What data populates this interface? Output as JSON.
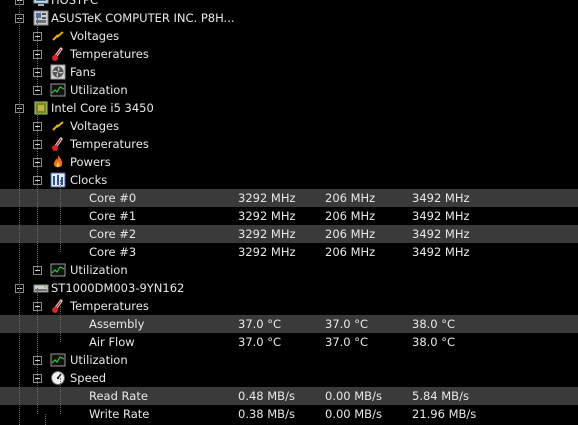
{
  "tree": {
    "root": {
      "label": "HOSTPC"
    },
    "motherboard": {
      "label": "ASUSTeK COMPUTER INC. P8H...",
      "children": [
        "Voltages",
        "Temperatures",
        "Fans",
        "Utilization"
      ]
    },
    "cpu": {
      "label": "Intel Core i5 3450",
      "children": {
        "voltages": "Voltages",
        "temperatures": "Temperatures",
        "powers": "Powers",
        "clocks": "Clocks",
        "utilization": "Utilization"
      },
      "clocks": [
        {
          "name": "Core #0",
          "value": "3292 MHz",
          "min": "206 MHz",
          "max": "3492 MHz"
        },
        {
          "name": "Core #1",
          "value": "3292 MHz",
          "min": "206 MHz",
          "max": "3492 MHz"
        },
        {
          "name": "Core #2",
          "value": "3292 MHz",
          "min": "206 MHz",
          "max": "3492 MHz"
        },
        {
          "name": "Core #3",
          "value": "3292 MHz",
          "min": "206 MHz",
          "max": "3492 MHz"
        }
      ]
    },
    "hdd": {
      "label": "ST1000DM003-9YN162",
      "children": {
        "temperatures": "Temperatures",
        "utilization": "Utilization",
        "speed": "Speed"
      },
      "temps": [
        {
          "name": "Assembly",
          "value": "37.0 °C",
          "min": "37.0 °C",
          "max": "38.0 °C"
        },
        {
          "name": "Air Flow",
          "value": "37.0 °C",
          "min": "37.0 °C",
          "max": "38.0 °C"
        }
      ],
      "speeds": [
        {
          "name": "Read Rate",
          "value": "0.48 MB/s",
          "min": "0.00 MB/s",
          "max": "5.84 MB/s"
        },
        {
          "name": "Write Rate",
          "value": "0.38 MB/s",
          "min": "0.00 MB/s",
          "max": "21.96 MB/s"
        }
      ]
    }
  },
  "colors": {
    "background": "#000000",
    "text": "#e8e8e8",
    "highlight": "#3a3a3a",
    "guide": "#6a6a6a"
  }
}
